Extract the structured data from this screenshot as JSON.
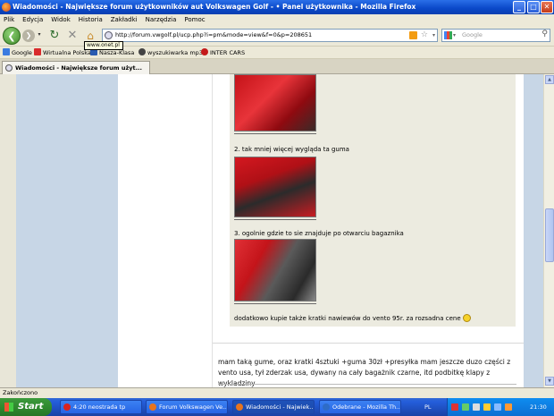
{
  "window": {
    "title": "Wiadomości - Największe forum użytkowników aut Volkswagen Golf - • Panel użytkownika - Mozilla Firefox",
    "controls": [
      "_",
      "□",
      "✕"
    ]
  },
  "menu": [
    "Plik",
    "Edycja",
    "Widok",
    "Historia",
    "Zakładki",
    "Narzędzia",
    "Pomoc"
  ],
  "nav": {
    "url": "http://forum.vwgolf.pl/ucp.php?i=pm&mode=view&f=0&p=208651",
    "search_placeholder": "Google",
    "tooltip": "www.onet.pl"
  },
  "bookmarks": [
    {
      "label": "Google",
      "color": "#3b7be0"
    },
    {
      "label": "Wirtualna Polska",
      "color": "#d92b2b"
    },
    {
      "label": "Nasza-Klasa",
      "color": "#2a5bb0"
    },
    {
      "label": "wyszukiwarka mp3",
      "color": "#444444"
    },
    {
      "label": "INTER CARS",
      "color": "#c41a1a"
    }
  ],
  "tab": {
    "label": "Wiadomości - Największe forum użyt..."
  },
  "message": {
    "caption_2": "2. tak mniej więcej wygląda ta guma",
    "caption_3": "3. ogolnie gdzie to sie znajduje po otwarciu bagaznika",
    "note": "dodatkowo kupie także kratki nawiewów do vento 95r. za rozsadna cene",
    "reply": "mam taką gume, oraz kratki 4sztuki +guma 30zł +presyłka mam jeszcze duzo części z vento usa, tył zderzak usa, dywany na cały bagażnik czarne, itd podbitkę klapy z wykladziny"
  },
  "status": {
    "text": "Zakończono"
  },
  "taskbar": {
    "start": "Start",
    "tasks": [
      "4:20 neostrada tp",
      "Forum Volkswagen Ve...",
      "Wiadomości - Najwiek...",
      "Odebrane - Mozilla Th..."
    ],
    "lang": "PL",
    "clock": "21:30"
  },
  "colors": {
    "page_bg": "#e8e6d8",
    "left_column": "#c7d6e6",
    "quote_bg": "#ecebe0",
    "accent": "#2a5bb0"
  }
}
